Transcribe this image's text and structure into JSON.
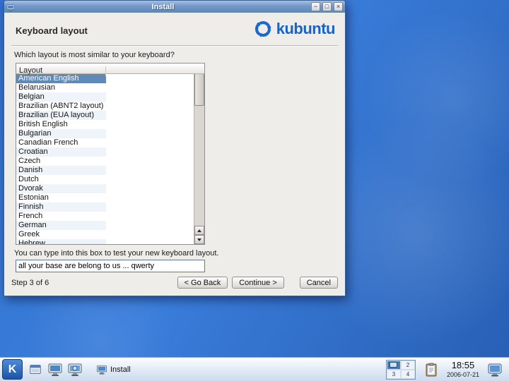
{
  "colors": {
    "titlebar_blue": "#5d88bb",
    "selection_blue": "#6189b5",
    "kubuntu_blue": "#1863c6",
    "desktop_blue": "#2e6bc4",
    "panel_blue": "#dfe9f4"
  },
  "window": {
    "title": "Install",
    "heading": "Keyboard layout",
    "logo_text": "kubuntu",
    "question": "Which layout is most similar to your keyboard?",
    "list": {
      "header": "Layout",
      "selected": "American English",
      "items": [
        "American English",
        "Belarusian",
        "Belgian",
        "Brazilian (ABNT2 layout)",
        "Brazilian (EUA layout)",
        "British English",
        "Bulgarian",
        "Canadian French",
        "Croatian",
        "Czech",
        "Danish",
        "Dutch",
        "Dvorak",
        "Estonian",
        "Finnish",
        "French",
        "German",
        "Greek",
        "Hebrew"
      ]
    },
    "test_label": "You can type into this box to test your new keyboard layout.",
    "test_value": "all your base are belong to us ... qwerty",
    "step_text": "Step 3 of 6",
    "buttons": {
      "back": "< Go Back",
      "continue": "Continue >",
      "cancel": "Cancel"
    }
  },
  "icons": {
    "minimize": "−",
    "maximize": "□",
    "close": "×",
    "kmenu": "K"
  },
  "taskbar": {
    "task_label": "Install",
    "pager": {
      "cells": [
        "1",
        "2",
        "3",
        "4"
      ],
      "active": "1"
    },
    "clock_time": "18:55",
    "clock_date": "2006-07-21"
  }
}
